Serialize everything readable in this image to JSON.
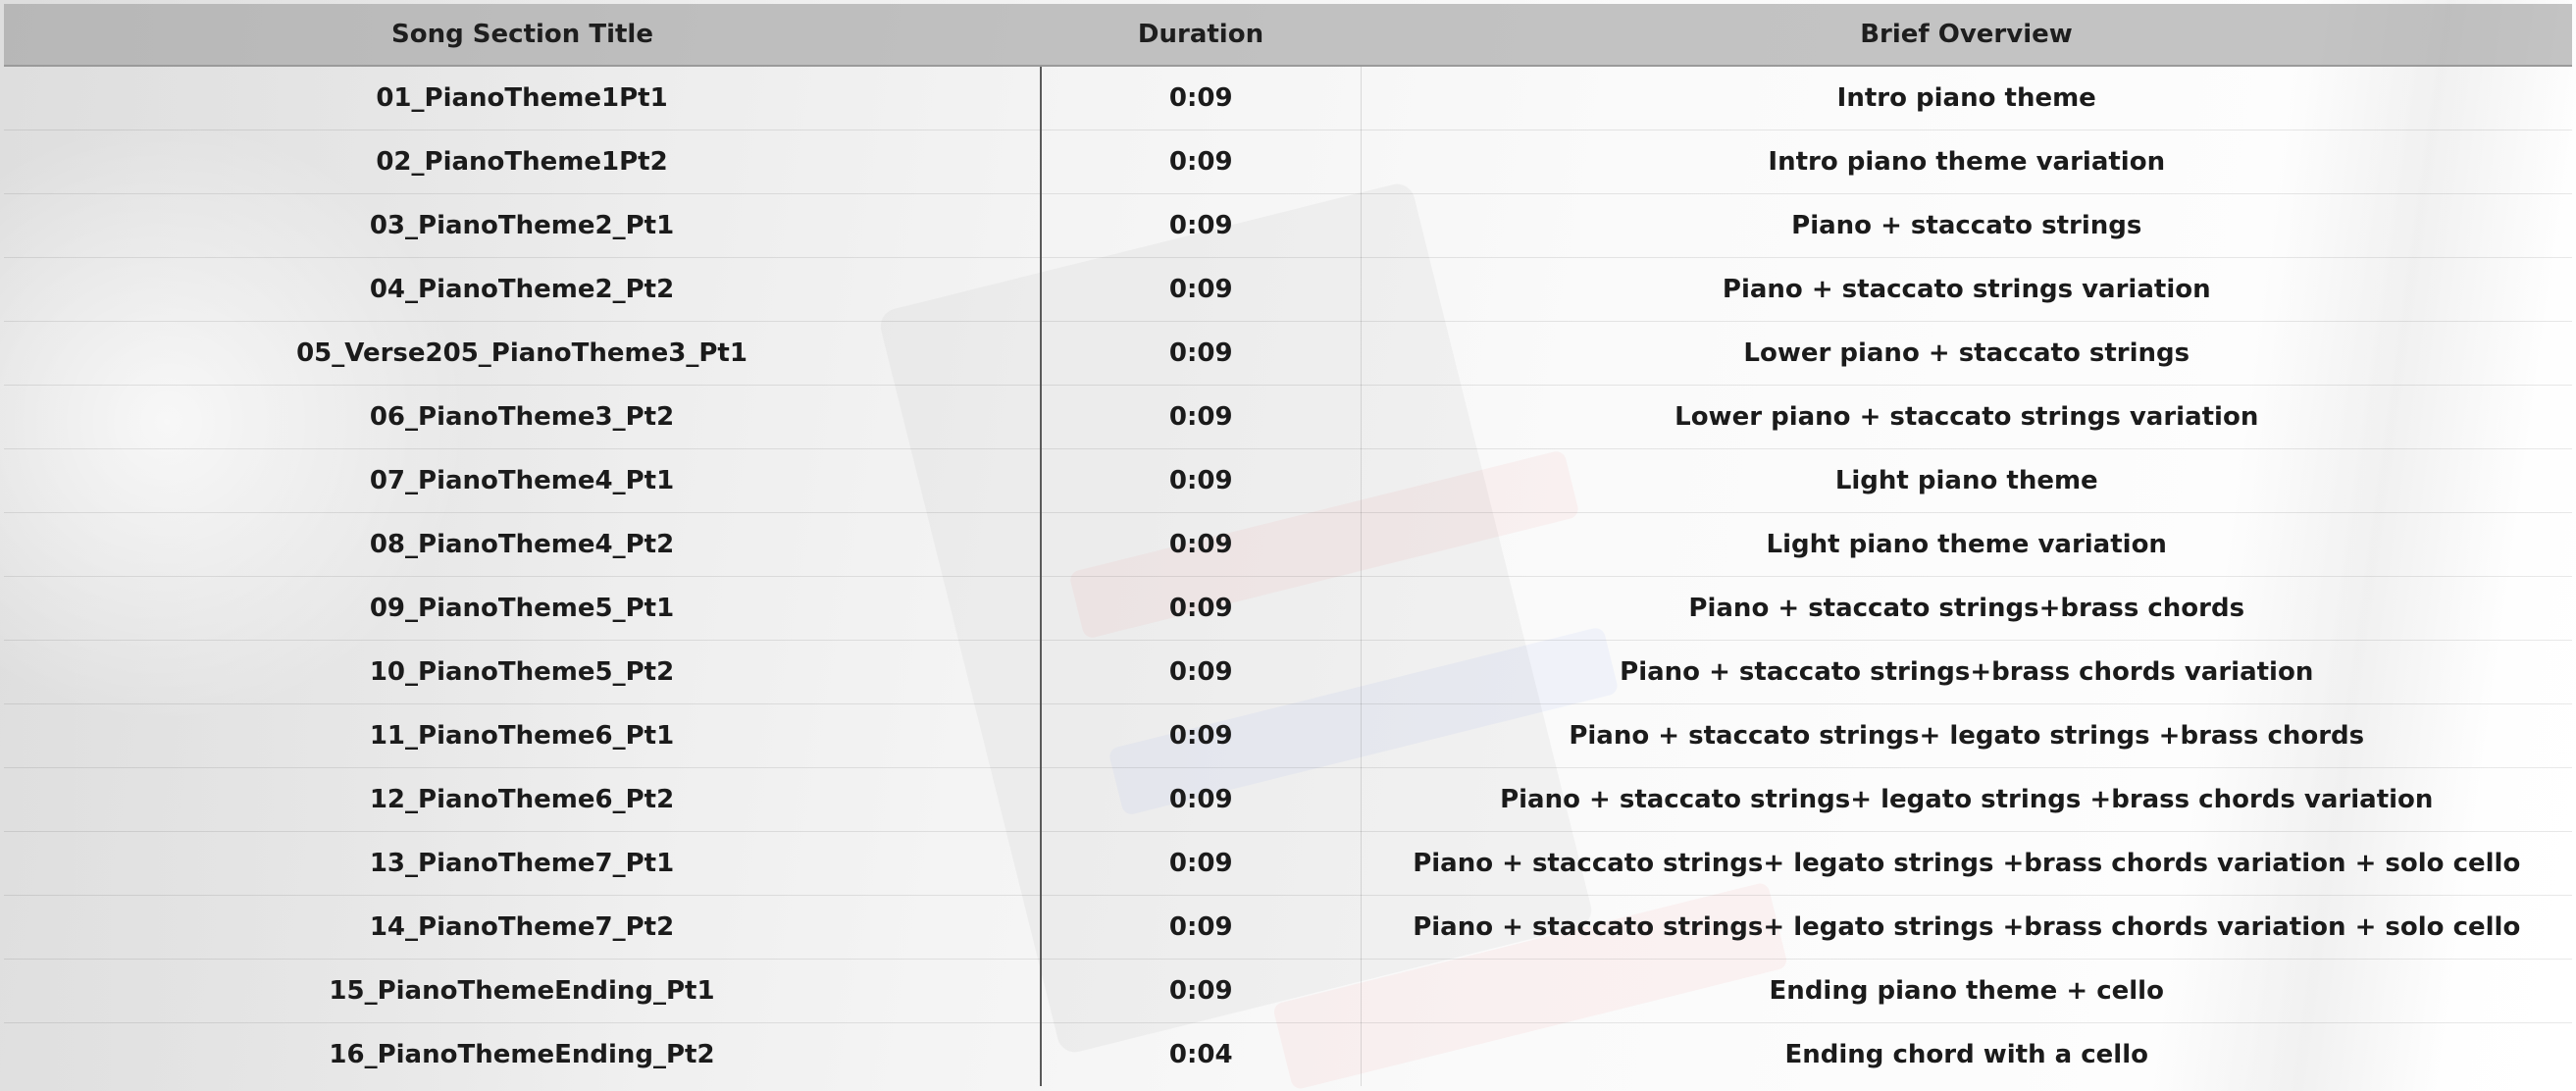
{
  "table": {
    "headers": [
      "Song Section Title",
      "Duration",
      "Brief Overview"
    ],
    "rows": [
      [
        "01_PianoTheme1Pt1",
        "0:09",
        "Intro piano theme"
      ],
      [
        "02_PianoTheme1Pt2",
        "0:09",
        "Intro piano theme variation"
      ],
      [
        "03_PianoTheme2_Pt1",
        "0:09",
        "Piano + staccato strings"
      ],
      [
        "04_PianoTheme2_Pt2",
        "0:09",
        "Piano + staccato strings variation"
      ],
      [
        "05_Verse205_PianoTheme3_Pt1",
        "0:09",
        "Lower piano + staccato strings"
      ],
      [
        "06_PianoTheme3_Pt2",
        "0:09",
        "Lower piano + staccato strings variation"
      ],
      [
        "07_PianoTheme4_Pt1",
        "0:09",
        "Light piano theme"
      ],
      [
        "08_PianoTheme4_Pt2",
        "0:09",
        "Light piano theme variation"
      ],
      [
        "09_PianoTheme5_Pt1",
        "0:09",
        "Piano + staccato strings+brass chords"
      ],
      [
        "10_PianoTheme5_Pt2",
        "0:09",
        "Piano + staccato strings+brass chords variation"
      ],
      [
        "11_PianoTheme6_Pt1",
        "0:09",
        "Piano + staccato strings+ legato strings +brass chords"
      ],
      [
        "12_PianoTheme6_Pt2",
        "0:09",
        "Piano + staccato strings+ legato strings +brass chords variation"
      ],
      [
        "13_PianoTheme7_Pt1",
        "0:09",
        "Piano + staccato strings+ legato strings +brass chords variation + solo cello"
      ],
      [
        "14_PianoTheme7_Pt2",
        "0:09",
        "Piano + staccato strings+ legato strings +brass chords variation + solo cello"
      ],
      [
        "15_PianoThemeEnding_Pt1",
        "0:09",
        "Ending piano theme + cello"
      ],
      [
        "16_PianoThemeEnding_Pt2",
        "0:04",
        "Ending chord with a cello"
      ]
    ]
  }
}
